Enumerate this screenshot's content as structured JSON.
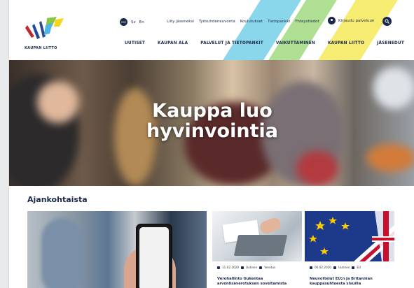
{
  "brand": {
    "logo_text": "KAUPAN LIITTO"
  },
  "lang": {
    "sv": "Sv",
    "en": "En"
  },
  "util_links": [
    "Liity jäseneksi",
    "Työsuhdeneuvonta",
    "Koulutukset",
    "Tietopankki",
    "Yhteystiedot"
  ],
  "login_label": "Kirjaudu palveluun",
  "main_nav": [
    "UUTISET",
    "KAUPAN ALA",
    "PALVELUT JA TIETOPANKIT",
    "VAIKUTTAMINEN",
    "KAUPAN LIITTO",
    "JÄSENEDUT"
  ],
  "hero": {
    "title": "Kauppa luo hyvinvointia"
  },
  "news": {
    "section_title": "Ajankohtaista",
    "cards": [
      {
        "date": "11.02.2020",
        "type": "Uutinen",
        "tag": "Verotus",
        "title": "Verohallinto tiukentaa arvonlisäverotuksen soveltamista"
      },
      {
        "date": "06.02.2020",
        "type": "Uutinen",
        "tag": "EU",
        "title": "Neuvottelut EU:n ja Britannian kauppasuhteesta sivuilla"
      }
    ]
  },
  "colors": {
    "navy": "#1b2a4a",
    "band_blue": "#7dd3ea",
    "band_green": "#a5dc86",
    "band_yellow": "#f5ea63"
  }
}
